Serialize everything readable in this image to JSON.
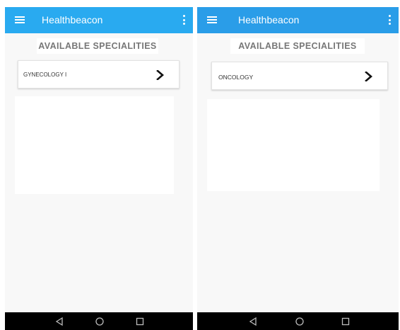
{
  "screens": [
    {
      "appbar": {
        "title": "Healthbeacon",
        "menu_icon": "hamburger-menu-icon",
        "overflow_icon": "more-vertical-icon"
      },
      "section_heading": "AVAILABLE SPECIALITIES",
      "specialties": [
        {
          "label": "GYNECOLOGY I",
          "icon": "chevron-right-icon"
        }
      ],
      "navbar": {
        "back_icon": "back-triangle-icon",
        "home_icon": "home-circle-icon",
        "recents_icon": "recents-square-icon"
      }
    },
    {
      "appbar": {
        "title": "Healthbeacon",
        "menu_icon": "hamburger-menu-icon",
        "overflow_icon": "more-vertical-icon"
      },
      "section_heading": "AVAILABLE SPECIALITIES",
      "specialties": [
        {
          "label": "ONCOLOGY",
          "icon": "chevron-right-icon"
        }
      ],
      "navbar": {
        "back_icon": "back-triangle-icon",
        "home_icon": "home-circle-icon",
        "recents_icon": "recents-square-icon"
      }
    }
  ],
  "colors": {
    "appbar_left": "#29aaf0",
    "appbar_right": "#2a9de8",
    "background": "#f8f8f8",
    "heading_text": "#777777",
    "navbar": "#000000"
  }
}
